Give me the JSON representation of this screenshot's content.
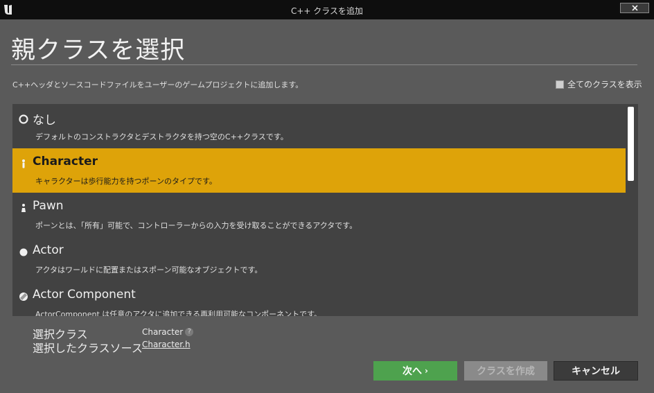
{
  "window": {
    "title": "C++ クラスを追加"
  },
  "heading": "親クラスを選択",
  "description": "C++ヘッダとソースコードファイルをユーザーのゲームプロジェクトに追加します。",
  "show_all_classes": {
    "label": "全てのクラスを表示",
    "checked": false
  },
  "class_list": [
    {
      "name": "なし",
      "description": "デフォルトのコンストラクタとデストラクタを持つ空のC++クラスです。",
      "icon": "none-circle-icon",
      "selected": false
    },
    {
      "name": "Character",
      "description": "キャラクターは歩行能力を持つポーンのタイプです。",
      "icon": "character-icon",
      "selected": true
    },
    {
      "name": "Pawn",
      "description": "ポーンとは、「所有」可能で、コントローラーからの入力を受け取ることができるアクタです。",
      "icon": "pawn-icon",
      "selected": false
    },
    {
      "name": "Actor",
      "description": "アクタはワールドに配置またはスポーン可能なオブジェクトです。",
      "icon": "actor-icon",
      "selected": false
    },
    {
      "name": "Actor Component",
      "description": "ActorComponent は任意のアクタに追加できる再利用可能なコンポーネントです。",
      "icon": "actor-component-icon",
      "selected": false
    }
  ],
  "selection": {
    "class_label": "選択クラス",
    "class_value": "Character",
    "source_label": "選択したクラスソース",
    "source_value": "Character.h"
  },
  "buttons": {
    "next": "次へ",
    "create": "クラスを作成",
    "cancel": "キャンセル"
  },
  "colors": {
    "selected_row": "#dea309",
    "next_button": "#4ea24e",
    "list_background": "#424242",
    "dialog_background": "#5a5a5a"
  }
}
